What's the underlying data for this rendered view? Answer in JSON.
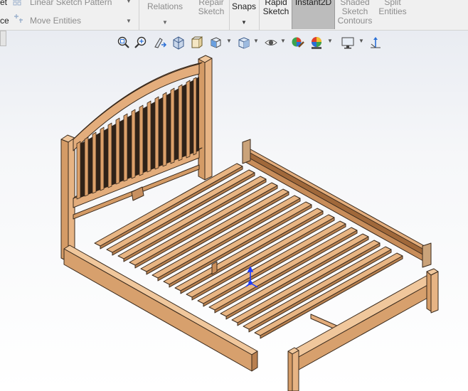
{
  "ribbon": {
    "cut_label_left": "et",
    "cut_label_left2": "ce",
    "linear_sketch_pattern": "Linear Sketch Pattern",
    "move_entities": "Move Entities",
    "relations_line1": "Relations",
    "repair_line1": "Repair",
    "repair_line2": "Sketch",
    "snaps": "Snaps",
    "rapid_line1": "Rapid",
    "rapid_line2": "Sketch",
    "instant2d": "Instant2D",
    "shaded_line1": "Shaded",
    "shaded_line2": "Sketch",
    "shaded_line3": "Contours",
    "split_line1": "Split",
    "split_line2": "Entities"
  },
  "colors": {
    "wood": "#dfa877",
    "wood_dark": "#b97e4c",
    "wood_edge": "#3a2a1c",
    "triad_blue": "#1f3cff"
  },
  "view_toolbar": [
    {
      "icon": "zoom-to-fit-icon"
    },
    {
      "icon": "zoom-to-area-icon"
    },
    {
      "icon": "previous-view-icon"
    },
    {
      "icon": "section-view-icon"
    },
    {
      "icon": "view-orientation-icon"
    },
    {
      "icon": "display-style-icon"
    },
    {
      "icon": "hide-show-items-icon"
    },
    {
      "icon": "edit-appearance-icon"
    },
    {
      "icon": "apply-scene-icon"
    },
    {
      "icon": "view-settings-icon"
    },
    {
      "icon": "coordinate-triad-icon"
    }
  ]
}
